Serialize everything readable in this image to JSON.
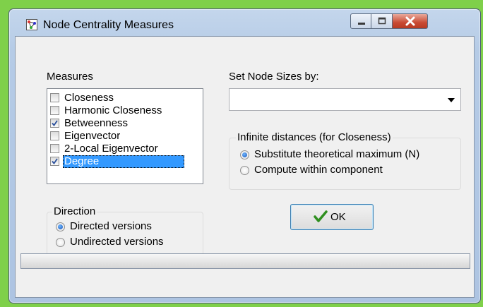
{
  "window": {
    "title": "Node Centrality Measures",
    "icon": "graph-app-icon",
    "accent_bg": "#7fd04a",
    "close_color": "#c94a33"
  },
  "measures": {
    "label": "Measures",
    "items": [
      {
        "label": "Closeness",
        "checked": false,
        "selected": false
      },
      {
        "label": "Harmonic Closeness",
        "checked": false,
        "selected": false
      },
      {
        "label": "Betweenness",
        "checked": true,
        "selected": false
      },
      {
        "label": "Eigenvector",
        "checked": false,
        "selected": false
      },
      {
        "label": "2-Local Eigenvector",
        "checked": false,
        "selected": false
      },
      {
        "label": "Degree",
        "checked": true,
        "selected": true
      }
    ]
  },
  "node_sizes": {
    "label": "Set Node Sizes by:",
    "value": ""
  },
  "infinite": {
    "title": "Infinite distances (for Closeness)",
    "options": [
      {
        "label": "Substitute theoretical maximum (N)",
        "selected": true
      },
      {
        "label": "Compute within component",
        "selected": false
      }
    ]
  },
  "direction": {
    "title": "Direction",
    "options": [
      {
        "label": "Directed versions",
        "selected": true
      },
      {
        "label": "Undirected versions",
        "selected": false
      }
    ]
  },
  "ok_button": {
    "label": "OK"
  }
}
